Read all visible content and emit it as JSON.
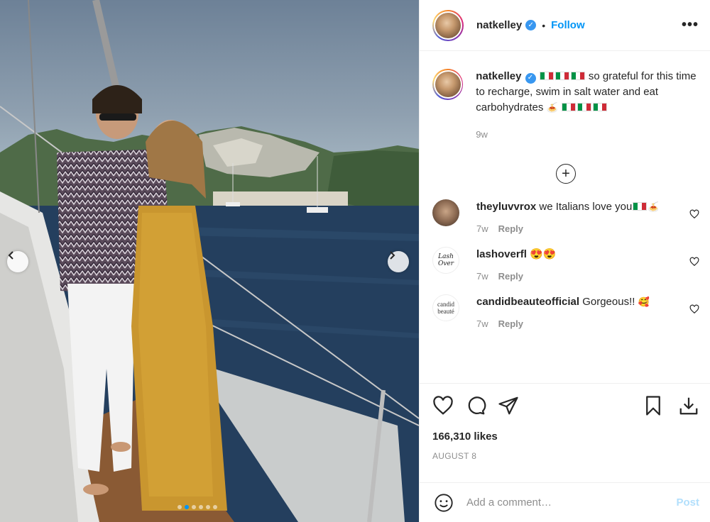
{
  "header": {
    "username": "natkelley",
    "separator": "•",
    "follow_label": "Follow",
    "more_label": "•••"
  },
  "caption": {
    "username": "natkelley",
    "text_1": "so grateful for this time to recharge, swim in salt water and eat carbohydrates",
    "emoji_pasta": "🍝",
    "time": "9w"
  },
  "comments": [
    {
      "username": "theyluvvrox",
      "text": "we Italians love you",
      "emoji": "🍝",
      "time": "7w",
      "reply": "Reply"
    },
    {
      "username": "lashoverfl",
      "text": "😍😍",
      "time": "7w",
      "reply": "Reply",
      "avatar_text": "Lash Over"
    },
    {
      "username": "candidbeauteofficial",
      "text": "Gorgeous!!",
      "emoji": "🥰",
      "time": "7w",
      "reply": "Reply",
      "avatar_text": "candid beauté"
    }
  ],
  "post": {
    "likes": "166,310 likes",
    "date": "AUGUST 8"
  },
  "add_comment": {
    "placeholder": "Add a comment…",
    "post_label": "Post"
  },
  "icons": [
    "more-icon",
    "verified-icon",
    "add-circle-icon",
    "heart-icon",
    "comment-icon",
    "share-icon",
    "bookmark-icon",
    "download-icon",
    "emoji-icon",
    "chevron-left-icon",
    "chevron-right-icon"
  ],
  "colors": {
    "accent": "#0095f6",
    "verified": "#3897f0",
    "muted": "#8e8e8e",
    "post_disabled": "#b2dffc"
  },
  "carousel": {
    "dot_count": 6,
    "active_dot": 1
  }
}
